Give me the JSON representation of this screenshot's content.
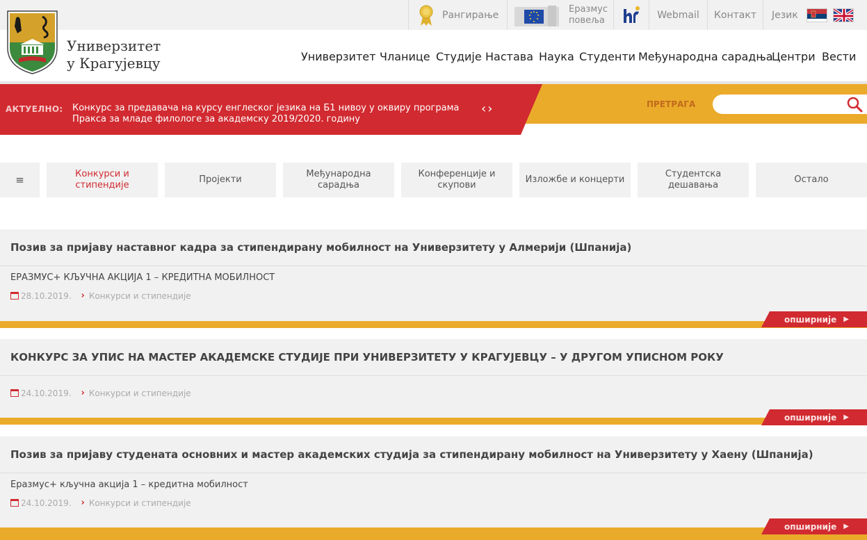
{
  "topbar": {
    "ranking_label": "Рангирање",
    "erasmus_line1": "Еразмус",
    "erasmus_line2": "повеља",
    "webmail_label": "Webmail",
    "contact_label": "Контакт",
    "language_label": "Језик"
  },
  "header": {
    "brand_line1": "Универзитет",
    "brand_line2": "у Крагујевцу"
  },
  "mainnav": {
    "items": [
      "Универзитет",
      "Чланице",
      "Студије",
      "Настава",
      "Наука",
      "Студенти",
      "Међународна сарадња",
      "Центри",
      "Вести"
    ]
  },
  "ticker": {
    "label": "АКТУЕЛНО:",
    "text": "Конкурс за предавача на курсу енглеског језика на Б1 нивоу у оквиру програма Пракса за младе филологе за академску 2019/2020. годину",
    "arrows": "‹›"
  },
  "search": {
    "label": "ПРЕТРАГА",
    "placeholder": ""
  },
  "tabs": {
    "menu_icon": "≡",
    "items": [
      "Конкурси и стипендије",
      "Пројекти",
      "Међународна сарадња",
      "Конференције и скупови",
      "Изложбе и концерти",
      "Студентска дешавања",
      "Остало"
    ]
  },
  "posts": [
    {
      "title": "Позив за пријаву наставног кадра за стипендирану мобилност на Универзитету у Алмерији (Шпанија)",
      "subtitle": "ЕРАЗМУС+ КЉУЧНА АКЦИЈА 1 – КРЕДИТНА МОБИЛНОСТ",
      "date": "28.10.2019.",
      "category": "Конкурси и стипендије",
      "more": "опширније"
    },
    {
      "title": "КОНКУРС ЗА УПИС НА МАСТЕР АКАДЕМСКЕ СТУДИЈЕ ПРИ УНИВЕРЗИТЕТУ У КРАГУЈЕВЦУ – У ДРУГОМ УПИСНОМ РОКУ",
      "subtitle": "",
      "date": "24.10.2019.",
      "category": "Конкурси и стипендије",
      "more": "опширније"
    },
    {
      "title": "Позив за пријаву студената основних и мастер академских студија за стипендирану мобилност на Универзитету у Хаену (Шпанија)",
      "subtitle": "Еразмус+ кључна акција 1 – кредитна мобилност",
      "date": "24.10.2019.",
      "category": "Конкурси и стипендије",
      "more": "опширније"
    }
  ],
  "colors": {
    "red": "#d12a30",
    "yellow": "#ebab2a",
    "grey": "#f1f1f1"
  }
}
